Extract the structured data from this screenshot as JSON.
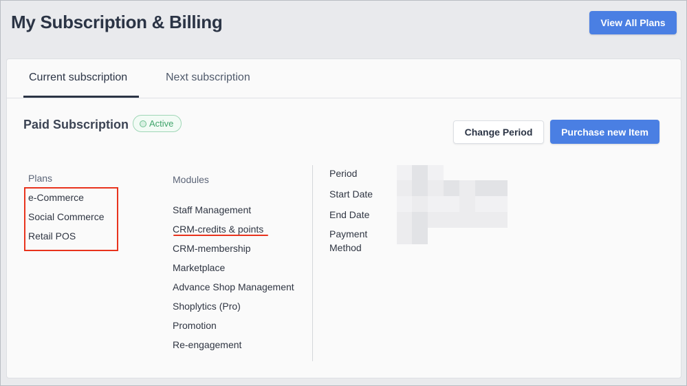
{
  "header": {
    "title": "My Subscription & Billing",
    "view_all_plans": "View All Plans"
  },
  "tabs": [
    {
      "label": "Current subscription",
      "active": true
    },
    {
      "label": "Next subscription",
      "active": false
    }
  ],
  "subscription": {
    "title": "Paid Subscription",
    "status": "Active",
    "change_period": "Change Period",
    "purchase_new_item": "Purchase new Item"
  },
  "plans": {
    "heading": "Plans",
    "items": [
      "e-Commerce",
      "Social Commerce",
      "Retail POS"
    ]
  },
  "modules": {
    "heading": "Modules",
    "items": [
      "Staff Management",
      "CRM-credits & points",
      "CRM-membership",
      "Marketplace",
      "Advance Shop Management",
      "Shoplytics (Pro)",
      "Promotion",
      "Re-engagement"
    ]
  },
  "details": {
    "labels": [
      "Period",
      "Start Date",
      "End Date",
      "Payment Method"
    ]
  },
  "colors": {
    "primary": "#4a7fe3",
    "active_green": "#3fa46a",
    "highlight_red": "#e8321c"
  }
}
